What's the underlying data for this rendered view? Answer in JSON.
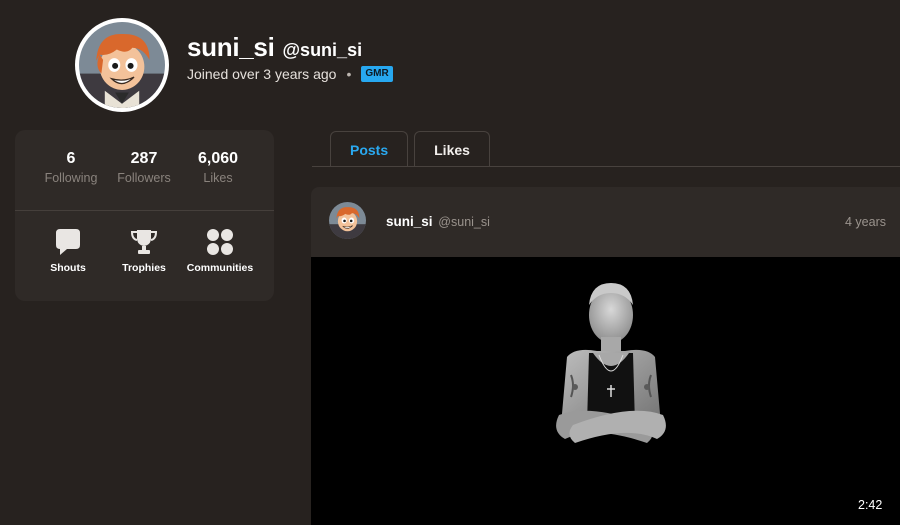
{
  "profile": {
    "display_name": "suni_si",
    "handle": "@suni_si",
    "joined": "Joined over 3 years ago",
    "separator": "•",
    "badge": "GMR",
    "avatar_icon": "cartoon-avatar-icon"
  },
  "stats": [
    {
      "value": "6",
      "label": "Following"
    },
    {
      "value": "287",
      "label": "Followers"
    },
    {
      "value": "6,060",
      "label": "Likes"
    }
  ],
  "shortcuts": [
    {
      "label": "Shouts",
      "icon": "speech-bubble-icon"
    },
    {
      "label": "Trophies",
      "icon": "trophy-icon"
    },
    {
      "label": "Communities",
      "icon": "communities-icon"
    }
  ],
  "tabs": [
    {
      "label": "Posts",
      "active": true
    },
    {
      "label": "Likes",
      "active": false
    }
  ],
  "post": {
    "author_name": "suni_si",
    "author_handle": "@suni_si",
    "time": "4 years",
    "duration": "2:42",
    "media_icon": "video-thumbnail"
  },
  "colors": {
    "background": "#27221f",
    "card": "#2f2a27",
    "accent": "#2aa9f0",
    "muted_text": "#8a837d"
  }
}
